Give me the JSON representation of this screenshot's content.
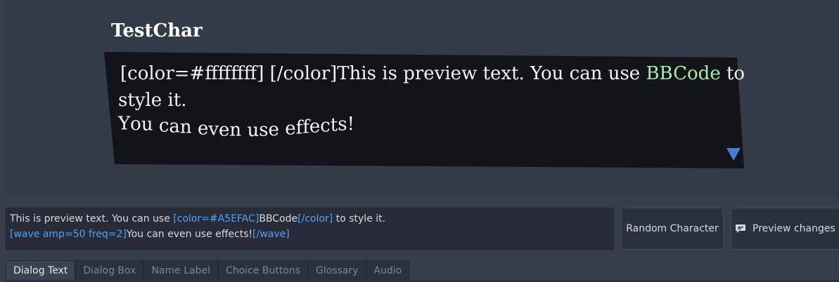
{
  "preview": {
    "character_name": "TestChar",
    "line1_tag": "[color=#ffffffff] [/color]",
    "line1_text": "This is preview text. You can use ",
    "line1_highlight": "BBCode",
    "line1_end": " to",
    "line2_text": "style it.",
    "line3_text": "You can even use effects!",
    "highlight_color": "#A5EFAC",
    "next_indicator_icon": "triangle-down-icon"
  },
  "editor": {
    "line1_plain": "This is preview text. You can use ",
    "line1_open_tag": "[color=#A5EFAC]",
    "line1_word": "BBCode",
    "line1_close_tag": "[/color]",
    "line1_end": " to style it.",
    "line2_open_tag": "[wave amp=50 freq=2]",
    "line2_text": "You can even use effects!",
    "line2_close_tag": "[/wave]"
  },
  "buttons": {
    "random_character": "Random Character",
    "preview_changes": "Preview changes",
    "preview_icon": "chat-bubble-icon"
  },
  "tabs": [
    {
      "label": "Dialog Text",
      "active": true
    },
    {
      "label": "Dialog Box",
      "active": false
    },
    {
      "label": "Name Label",
      "active": false
    },
    {
      "label": "Choice Buttons",
      "active": false
    },
    {
      "label": "Glossary",
      "active": false
    },
    {
      "label": "Audio",
      "active": false
    }
  ],
  "colors": {
    "tag_blue": "#4FA3F7",
    "indicator_blue": "#4A7BD6",
    "textbox_bg": "#131419"
  }
}
